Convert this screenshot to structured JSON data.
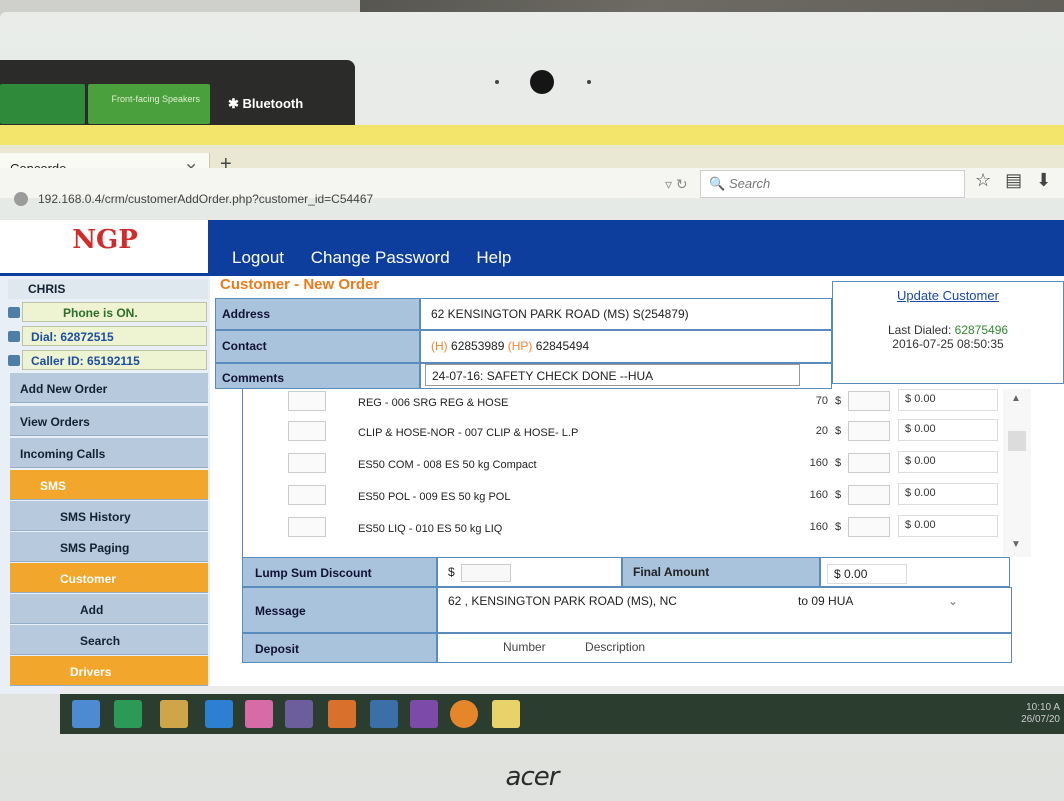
{
  "os": {
    "tiles": [
      "Front-facing Speakers",
      "Bluetooth"
    ],
    "taskbar_time": "10:10 A",
    "taskbar_date": "26/07/20",
    "brand": "acer"
  },
  "browser": {
    "tab_title": "Concorde",
    "url": "192.168.0.4/crm/customerAddOrder.php?customer_id=C54467",
    "search_placeholder": "Search"
  },
  "header": {
    "logo": "NGP",
    "nav": [
      "Logout",
      "Change Password",
      "Help"
    ]
  },
  "sidebar": {
    "user": "CHRIS",
    "phone_status": "Phone is ON.",
    "dial": "Dial: 62872515",
    "caller_id": "Caller ID: 65192115",
    "menu": [
      {
        "label": "Add New Order",
        "type": "item"
      },
      {
        "label": "View Orders",
        "type": "item"
      },
      {
        "label": "Incoming Calls",
        "type": "item"
      },
      {
        "label": "SMS",
        "type": "section"
      },
      {
        "label": "SMS History",
        "type": "item"
      },
      {
        "label": "SMS Paging",
        "type": "item"
      },
      {
        "label": "Customer",
        "type": "section"
      },
      {
        "label": "Add",
        "type": "sub"
      },
      {
        "label": "Search",
        "type": "sub"
      },
      {
        "label": "Drivers",
        "type": "section"
      }
    ]
  },
  "form": {
    "title": "Customer - New Order",
    "address_label": "Address",
    "address": "62 KENSINGTON PARK ROAD (MS) S(254879)",
    "contact_label": "Contact",
    "contact_h_tag": "(H)",
    "contact_h": "62853989",
    "contact_hp_tag": "(HP)",
    "contact_hp": "62845494",
    "comments_label": "Comments",
    "comments": "24-07-16: SAFETY CHECK DONE --HUA",
    "update_link": "Update Customer",
    "last_dialed_label": "Last Dialed:",
    "last_dialed_number": "62875496",
    "last_dialed_time": "2016-07-25 08:50:35",
    "items": [
      {
        "desc": "REG - 006 SRG REG & HOSE",
        "price": "70",
        "amount": "0.00"
      },
      {
        "desc": "CLIP & HOSE-NOR - 007 CLIP & HOSE- L.P",
        "price": "20",
        "amount": "0.00"
      },
      {
        "desc": "ES50 COM - 008 ES 50 kg Compact",
        "price": "160",
        "amount": "0.00"
      },
      {
        "desc": "ES50 POL - 009 ES 50 kg POL",
        "price": "160",
        "amount": "0.00"
      },
      {
        "desc": "ES50 LIQ - 010 ES 50 kg LIQ",
        "price": "160",
        "amount": "0.00"
      }
    ],
    "currency": "$",
    "lump_label": "Lump Sum Discount",
    "final_label": "Final Amount",
    "final_amount": "0.00",
    "message_label": "Message",
    "message": "62 , KENSINGTON PARK ROAD (MS), NC",
    "message_to": "to 09 HUA",
    "deposit_label": "Deposit",
    "deposit_number": "Number",
    "deposit_desc": "Description"
  }
}
